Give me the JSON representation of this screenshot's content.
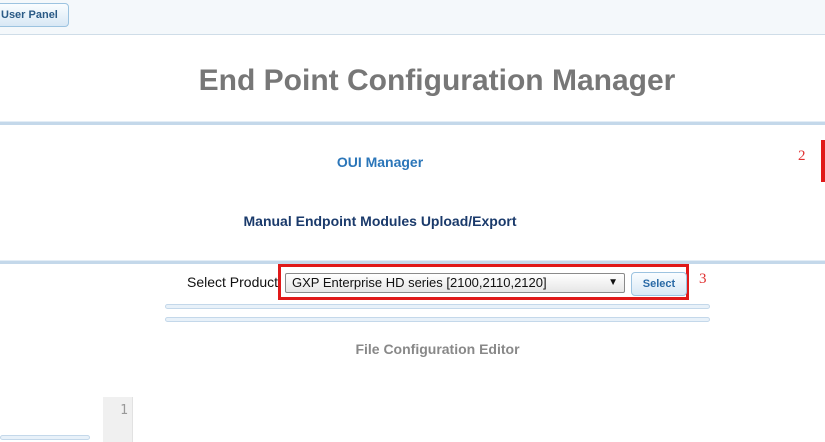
{
  "topbar": {
    "user_panel_label": "User Panel"
  },
  "page_title": "End Point Configuration Manager",
  "links": {
    "oui_manager": "OUI Manager",
    "manual_modules": "Manual Endpoint Modules Upload/Export"
  },
  "annotations": {
    "mark_2": "2",
    "mark_3": "3"
  },
  "product": {
    "label": "Select Product:",
    "selected": "GXP Enterprise HD series [2100,2110,2120]",
    "button": "Select"
  },
  "editor": {
    "title": "File Configuration Editor",
    "line_numbers": [
      "1"
    ]
  },
  "colors": {
    "accent": "#2b76b9",
    "highlight": "#e01919",
    "title_gray": "#777777"
  }
}
